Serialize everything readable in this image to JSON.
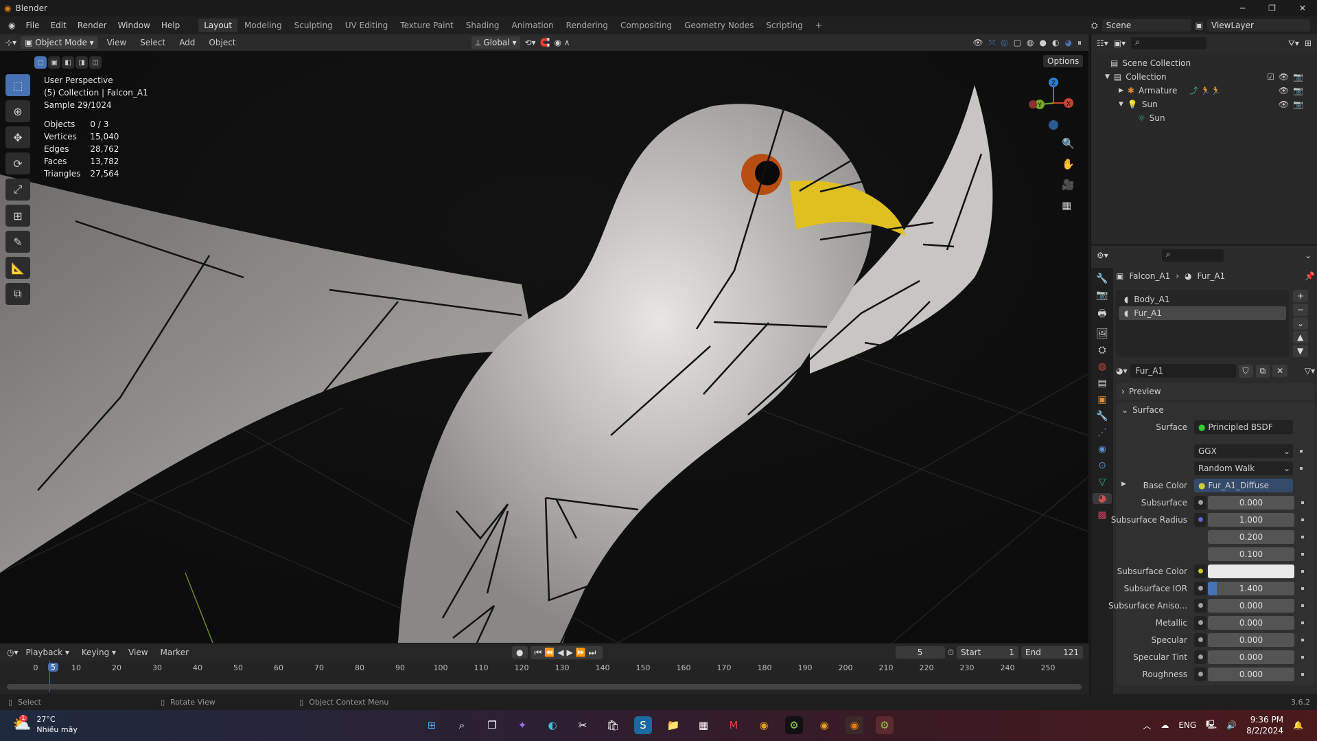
{
  "app": {
    "title": "Blender",
    "version": "3.6.2"
  },
  "menu": [
    "File",
    "Edit",
    "Render",
    "Window",
    "Help"
  ],
  "workspaces": [
    "Layout",
    "Modeling",
    "Sculpting",
    "UV Editing",
    "Texture Paint",
    "Shading",
    "Animation",
    "Rendering",
    "Compositing",
    "Geometry Nodes",
    "Scripting",
    "+"
  ],
  "scene": {
    "name": "Scene",
    "view_layer": "ViewLayer"
  },
  "viewport_header": {
    "mode": "Object Mode",
    "menus": [
      "View",
      "Select",
      "Add",
      "Object"
    ],
    "orientation": "Global",
    "options": "Options"
  },
  "overlay": {
    "view": "User Perspective",
    "collection": "(5) Collection | Falcon_A1",
    "sample": "Sample 29/1024",
    "stats": [
      {
        "k": "Objects",
        "v": "0 / 3"
      },
      {
        "k": "Vertices",
        "v": "15,040"
      },
      {
        "k": "Edges",
        "v": "28,762"
      },
      {
        "k": "Faces",
        "v": "13,782"
      },
      {
        "k": "Triangles",
        "v": "27,564"
      }
    ]
  },
  "gizmo": {
    "z": "Z",
    "x": "X",
    "y": "Y"
  },
  "outliner": {
    "root": "Scene Collection",
    "items": [
      {
        "name": "Collection"
      },
      {
        "name": "Armature"
      },
      {
        "name": "Sun"
      },
      {
        "name": "Sun"
      }
    ]
  },
  "properties": {
    "breadcrumb_object": "Falcon_A1",
    "breadcrumb_material": "Fur_A1",
    "slots": [
      "Body_A1",
      "Fur_A1"
    ],
    "material_name": "Fur_A1",
    "panels": {
      "preview": "Preview",
      "surface": "Surface"
    },
    "surface_label": "Surface",
    "surface_shader": "Principled BSDF",
    "distribution": "GGX",
    "subsurface_method": "Random Walk",
    "base_color_label": "Base Color",
    "base_color_value": "Fur_A1_Diffuse",
    "fields": [
      {
        "label": "Subsurface",
        "value": "0.000",
        "socket": "#a0a0a0"
      },
      {
        "label": "Subsurface Radius",
        "value": "1.000",
        "socket": "#6363c7"
      },
      {
        "label": "",
        "value": "0.200"
      },
      {
        "label": "",
        "value": "0.100"
      },
      {
        "label": "Subsurface Color",
        "value": "",
        "socket": "#c7c729",
        "color": "#e8e8e8"
      },
      {
        "label": "Subsurface IOR",
        "value": "1.400",
        "socket": "#a0a0a0",
        "fill": 0.1
      },
      {
        "label": "Subsurface Aniso...",
        "value": "0.000",
        "socket": "#a0a0a0"
      },
      {
        "label": "Metallic",
        "value": "0.000",
        "socket": "#a0a0a0"
      },
      {
        "label": "Specular",
        "value": "0.000",
        "socket": "#a0a0a0"
      },
      {
        "label": "Specular Tint",
        "value": "0.000",
        "socket": "#a0a0a0"
      },
      {
        "label": "Roughness",
        "value": "0.000",
        "socket": "#a0a0a0"
      }
    ]
  },
  "timeline": {
    "menus": [
      "Playback",
      "Keying",
      "View",
      "Marker"
    ],
    "current_frame": "5",
    "start_label": "Start",
    "start": "1",
    "end_label": "End",
    "end": "121",
    "ticks": [
      "0",
      "10",
      "20",
      "30",
      "40",
      "50",
      "60",
      "70",
      "80",
      "90",
      "100",
      "110",
      "120",
      "130",
      "140",
      "150",
      "160",
      "170",
      "180",
      "190",
      "200",
      "210",
      "220",
      "230",
      "240",
      "250"
    ]
  },
  "status": {
    "select": "Select",
    "rotate": "Rotate View",
    "context": "Object Context Menu"
  },
  "taskbar": {
    "temp": "27°C",
    "weather": "Nhiều mây",
    "lang": "ENG",
    "time": "9:36 PM",
    "date": "8/2/2024",
    "badge": "1"
  }
}
